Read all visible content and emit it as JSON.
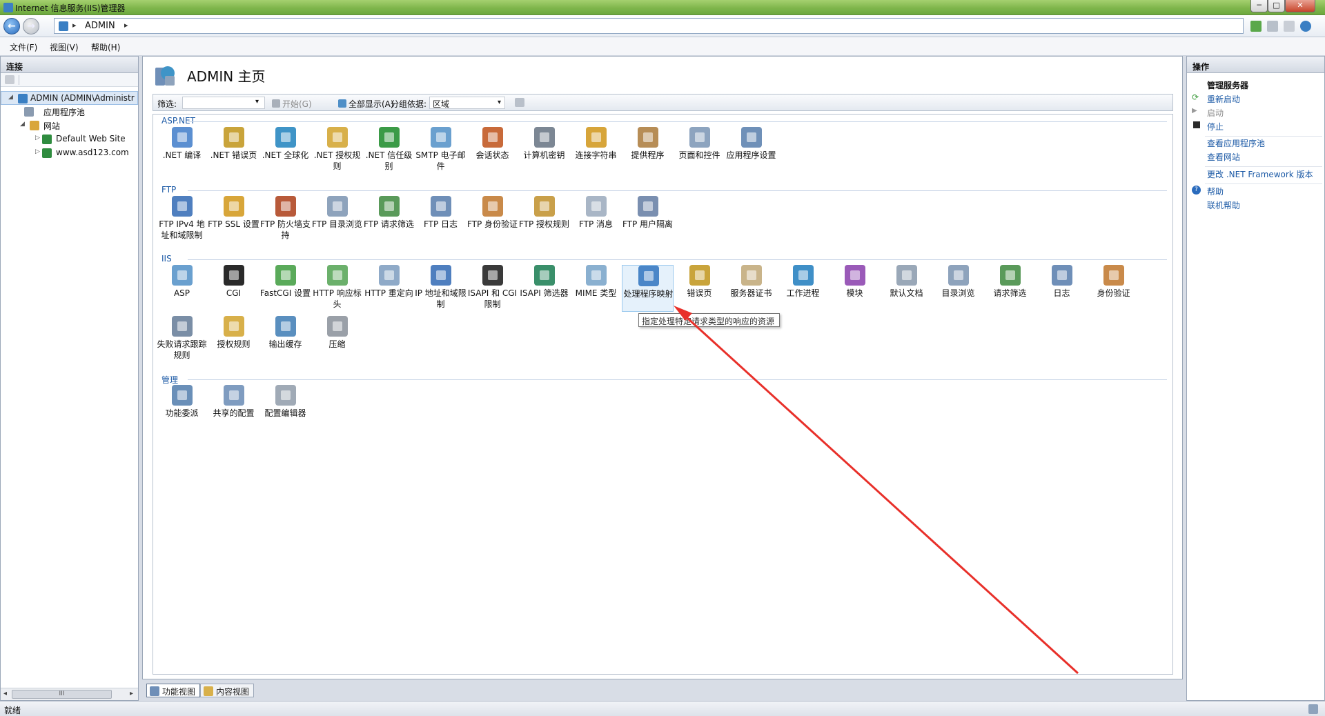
{
  "window": {
    "title": "Internet 信息服务(IIS)管理器",
    "min": "─",
    "max": "□",
    "close": "✕"
  },
  "address": {
    "sep": "▸",
    "crumb": "ADMIN",
    "sep2": "▸"
  },
  "menu": [
    "文件(F)",
    "视图(V)",
    "帮助(H)"
  ],
  "left": {
    "header": "连接",
    "tree": [
      {
        "label": "ADMIN (ADMIN\\Administr",
        "twisty": "◢",
        "color": "#3a7fc3"
      },
      {
        "label": "应用程序池",
        "twisty": "",
        "color": "#8a9bb0"
      },
      {
        "label": "网站",
        "twisty": "◢",
        "color": "#d9a63a"
      },
      {
        "label": "Default Web Site",
        "twisty": "▷",
        "color": "#2f8c3f"
      },
      {
        "label": "www.asd123.com",
        "twisty": "▷",
        "color": "#2f8c3f"
      }
    ],
    "scroll": "III"
  },
  "center": {
    "title": "ADMIN 主页",
    "filter": {
      "label": "筛选:",
      "start": "开始(G)",
      "show_all": "全部显示(A)",
      "group_label": "分组依据:",
      "group_value": "区域",
      "dropdown": "▾"
    },
    "sections": [
      {
        "title": "ASP.NET",
        "items": [
          {
            "label": ".NET 编译",
            "color": "#5b8fd1"
          },
          {
            "label": ".NET 错误页",
            "color": "#c9a43b"
          },
          {
            "label": ".NET 全球化",
            "color": "#3f94c7"
          },
          {
            "label": ".NET 授权规则",
            "color": "#d8b04a"
          },
          {
            "label": ".NET 信任级别",
            "color": "#3b9b47"
          },
          {
            "label": "SMTP 电子邮件",
            "color": "#6aa0cf"
          },
          {
            "label": "会话状态",
            "color": "#c86a3a"
          },
          {
            "label": "计算机密钥",
            "color": "#7c8794"
          },
          {
            "label": "连接字符串",
            "color": "#d7a53a"
          },
          {
            "label": "提供程序",
            "color": "#b78d56"
          },
          {
            "label": "页面和控件",
            "color": "#8da4bf"
          },
          {
            "label": "应用程序设置",
            "color": "#6f90b8"
          }
        ]
      },
      {
        "title": "FTP",
        "items": [
          {
            "label": "FTP IPv4 地址和域限制",
            "color": "#4f7fbf"
          },
          {
            "label": "FTP SSL 设置",
            "color": "#d8a63a"
          },
          {
            "label": "FTP 防火墙支持",
            "color": "#b85a3a"
          },
          {
            "label": "FTP 目录浏览",
            "color": "#8ea3bc"
          },
          {
            "label": "FTP 请求筛选",
            "color": "#5a9a5a"
          },
          {
            "label": "FTP 日志",
            "color": "#6f8fb8"
          },
          {
            "label": "FTP 身份验证",
            "color": "#c98a4a"
          },
          {
            "label": "FTP 授权规则",
            "color": "#c9a04a"
          },
          {
            "label": "FTP 消息",
            "color": "#a9b6c6"
          },
          {
            "label": "FTP 用户隔离",
            "color": "#7a8fb0"
          }
        ]
      },
      {
        "title": "IIS",
        "items": [
          {
            "label": "ASP",
            "color": "#6aa0cf"
          },
          {
            "label": "CGI",
            "color": "#2a2a2a"
          },
          {
            "label": "FastCGI 设置",
            "color": "#5aaa5a"
          },
          {
            "label": "HTTP 响应标头",
            "color": "#6bb06b"
          },
          {
            "label": "HTTP 重定向",
            "color": "#8faac8"
          },
          {
            "label": "IP 地址和域限制",
            "color": "#4f7fbf"
          },
          {
            "label": "ISAPI 和 CGI 限制",
            "color": "#3a3a3a"
          },
          {
            "label": "ISAPI 筛选器",
            "color": "#3a8f6a"
          },
          {
            "label": "MIME 类型",
            "color": "#8ab0d0"
          },
          {
            "label": "处理程序映射",
            "color": "#4a86c8"
          },
          {
            "label": "错误页",
            "color": "#c9a43b"
          },
          {
            "label": "服务器证书",
            "color": "#c9b48a"
          },
          {
            "label": "工作进程",
            "color": "#3f8fc7"
          },
          {
            "label": "模块",
            "color": "#9a5ab8"
          },
          {
            "label": "默认文档",
            "color": "#9aa8b8"
          },
          {
            "label": "目录浏览",
            "color": "#8ea3bc"
          },
          {
            "label": "请求筛选",
            "color": "#5a9a5a"
          },
          {
            "label": "日志",
            "color": "#6f8fb8"
          },
          {
            "label": "身份验证",
            "color": "#c98a4a"
          },
          {
            "label": "失败请求跟踪规则",
            "color": "#7a8ea6"
          },
          {
            "label": "授权规则",
            "color": "#d8b04a"
          },
          {
            "label": "输出缓存",
            "color": "#5a8fbf"
          },
          {
            "label": "压缩",
            "color": "#9aa0a8"
          }
        ]
      },
      {
        "title": "管理",
        "items": [
          {
            "label": "功能委派",
            "color": "#6a8fb8"
          },
          {
            "label": "共享的配置",
            "color": "#7f9cc0"
          },
          {
            "label": "配置编辑器",
            "color": "#a0aab6"
          }
        ]
      }
    ],
    "tooltip": "指定处理特定请求类型的响应的资源",
    "tabs": [
      "功能视图",
      "内容视图"
    ]
  },
  "right": {
    "header": "操作",
    "group": "管理服务器",
    "actions": [
      "重新启动",
      "启动",
      "停止",
      "查看应用程序池",
      "查看网站",
      "更改 .NET Framework 版本",
      "帮助",
      "联机帮助"
    ]
  },
  "status": "就绪",
  "annotation_color": "#e8302a"
}
